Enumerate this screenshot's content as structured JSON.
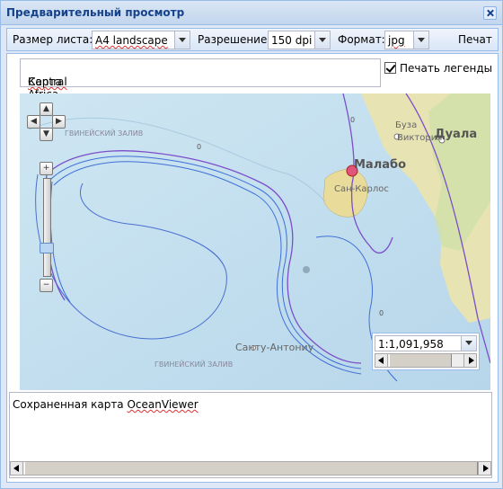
{
  "window": {
    "title": "Предварительный просмотр"
  },
  "toolbar": {
    "page_size_label": "Размер листа:",
    "page_size_value": "A4 landscape",
    "resolution_label": "Разрешение:",
    "resolution_value": "150 dpi",
    "format_label": "Формат:",
    "format_value": "jpg",
    "print_label": "Печат"
  },
  "map_title": {
    "prefix": "Карта ",
    "name": "Central Africa"
  },
  "legend": {
    "label": "Печать легенды",
    "checked": true
  },
  "map": {
    "labels": {
      "malabo": "Малабо",
      "san_carlos": "Сан-Карлос",
      "buza": "Буза",
      "victoria": "Виктория",
      "duala": "Дуала",
      "santu_antoniu": "Санту-Антониу",
      "gulf_top": "ГВИНЕЙСКИЙ ЗАЛИВ",
      "gulf_bottom": "ГВИНЕЙСКИЙ ЗАЛИВ",
      "zero_a": "0",
      "zero_b": "0",
      "zero_c": "0"
    },
    "scale": "1:1,091,958"
  },
  "description": {
    "prefix": "Сохраненная карта ",
    "name": "OceanViewer"
  },
  "colors": {
    "title_text": "#15428b",
    "border": "#99bbe8",
    "contour_purple": "#7b4fc9",
    "contour_blue": "#3f6fd6",
    "sea": "#c3e0ef",
    "land": "#e8dfa0"
  },
  "icons": [
    "close-icon",
    "pan-up-icon",
    "pan-left-icon",
    "pan-right-icon",
    "pan-down-icon",
    "zoom-in-icon",
    "zoom-out-icon",
    "chevron-down-icon",
    "checkbox-checked-icon"
  ]
}
